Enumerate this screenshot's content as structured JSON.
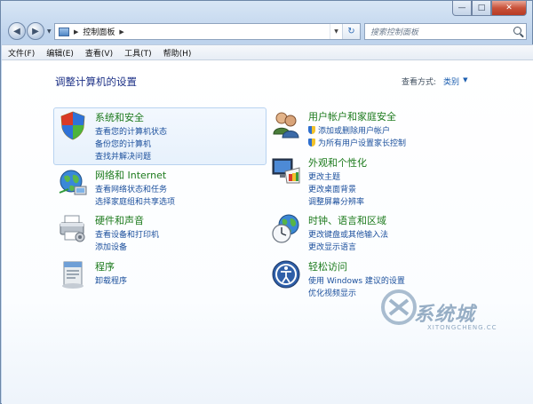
{
  "window": {
    "minimize_glyph": "—",
    "maximize_glyph": "□",
    "close_glyph": "✕"
  },
  "nav": {
    "back_glyph": "◀",
    "forward_glyph": "▶",
    "dropdown_glyph": "▼"
  },
  "address": {
    "separator": "▶",
    "path": "控制面板",
    "trail": "▶",
    "dropdown_glyph": "▼",
    "refresh_glyph": "↻"
  },
  "search": {
    "placeholder": "搜索控制面板"
  },
  "menu": [
    {
      "label": "文件(F)"
    },
    {
      "label": "编辑(E)"
    },
    {
      "label": "查看(V)"
    },
    {
      "label": "工具(T)"
    },
    {
      "label": "帮助(H)"
    }
  ],
  "page": {
    "title": "调整计算机的设置",
    "view_by_label": "查看方式:",
    "view_by_value": "类别",
    "view_by_arrow": "▼"
  },
  "categories": [
    {
      "title": "系统和安全",
      "icon": "shield-icon",
      "links": [
        "查看您的计算机状态",
        "备份您的计算机",
        "查找并解决问题"
      ]
    },
    {
      "title": "网络和 Internet",
      "icon": "network-globe-icon",
      "links": [
        "查看网络状态和任务",
        "选择家庭组和共享选项"
      ]
    },
    {
      "title": "硬件和声音",
      "icon": "printer-icon",
      "links": [
        "查看设备和打印机",
        "添加设备"
      ]
    },
    {
      "title": "程序",
      "icon": "programs-icon",
      "links": [
        "卸载程序"
      ]
    },
    {
      "title": "用户帐户和家庭安全",
      "icon": "users-icon",
      "links": [
        "添加或删除用户帐户",
        "为所有用户设置家长控制"
      ]
    },
    {
      "title": "外观和个性化",
      "icon": "monitor-palette-icon",
      "links": [
        "更改主题",
        "更改桌面背景",
        "调整屏幕分辨率"
      ]
    },
    {
      "title": "时钟、语言和区域",
      "icon": "clock-globe-icon",
      "links": [
        "更改键盘或其他输入法",
        "更改显示语言"
      ]
    },
    {
      "title": "轻松访问",
      "icon": "ease-of-access-icon",
      "links": [
        "使用 Windows 建议的设置",
        "优化视频显示"
      ]
    }
  ],
  "watermark": {
    "text": "系统城",
    "sub": "XITONGCHENG.CC"
  },
  "colors": {
    "category_title": "#1c7a1c",
    "link": "#1b4f9c",
    "page_title": "#1e3287"
  }
}
